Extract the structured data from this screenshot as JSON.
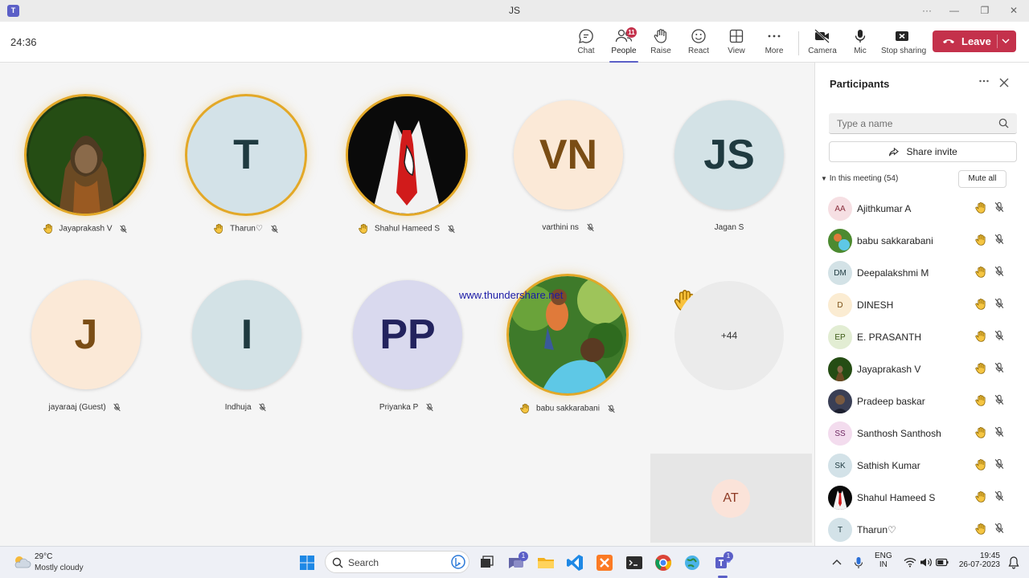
{
  "window": {
    "title": "JS",
    "more": "···",
    "minimize": "—",
    "maximize": "❐",
    "close": "✕"
  },
  "header": {
    "timer": "24:36",
    "tools": [
      {
        "id": "chat",
        "label": "Chat"
      },
      {
        "id": "people",
        "label": "People",
        "badge": "11",
        "active": true
      },
      {
        "id": "raise",
        "label": "Raise"
      },
      {
        "id": "react",
        "label": "React"
      },
      {
        "id": "view",
        "label": "View"
      },
      {
        "id": "more",
        "label": "More"
      },
      {
        "id": "camera",
        "label": "Camera"
      },
      {
        "id": "mic",
        "label": "Mic"
      },
      {
        "id": "share",
        "label": "Stop sharing"
      }
    ],
    "leave_label": "Leave"
  },
  "stage": {
    "tiles": [
      {
        "name": "Jayaprakash V",
        "initials": "",
        "raised": true,
        "muted": true,
        "photo": "hooded-man"
      },
      {
        "name": "Tharun♡",
        "initials": "T",
        "raised": true,
        "muted": true,
        "bg": "#d3e2e8",
        "fg": "#1f3a40"
      },
      {
        "name": "Shahul Hameed S",
        "initials": "",
        "raised": true,
        "muted": true,
        "photo": "suit-tie"
      },
      {
        "name": "varthini ns",
        "initials": "VN",
        "raised": false,
        "muted": true,
        "bg": "#fbe9d7",
        "fg": "#7a4d15"
      },
      {
        "name": "Jagan S",
        "initials": "JS",
        "raised": false,
        "muted": false,
        "bg": "#d3e2e6",
        "fg": "#1f3a40"
      },
      {
        "name": "jayaraaj (Guest)",
        "initials": "J",
        "raised": false,
        "muted": true,
        "bg": "#fbe9d7",
        "fg": "#7a4d15"
      },
      {
        "name": "Indhuja",
        "initials": "I",
        "raised": false,
        "muted": true,
        "bg": "#d3e2e6",
        "fg": "#1f3a40"
      },
      {
        "name": "Priyanka P",
        "initials": "PP",
        "raised": false,
        "muted": true,
        "bg": "#d9d9ee",
        "fg": "#23235e"
      },
      {
        "name": "babu sakkarabani",
        "initials": "",
        "raised": true,
        "muted": true,
        "photo": "father-child"
      }
    ],
    "overflow_label": "+44",
    "watermark": "www.thundershare.net",
    "self_initials": "AT"
  },
  "panel": {
    "title": "Participants",
    "search_placeholder": "Type a name",
    "share_invite": "Share invite",
    "in_meeting": "In this meeting (54)",
    "mute_all": "Mute all",
    "participants": [
      {
        "initials": "AA",
        "name": "Ajithkumar A",
        "bg": "#f6dfe3",
        "fg": "#8a2f3d"
      },
      {
        "initials": "",
        "name": "babu sakkarabani",
        "photo": "green"
      },
      {
        "initials": "DM",
        "name": "Deepalakshmi M",
        "bg": "#d3e2e6",
        "fg": "#1f3a40"
      },
      {
        "initials": "D",
        "name": "DINESH",
        "bg": "#fbecd2",
        "fg": "#7a4d15"
      },
      {
        "initials": "EP",
        "name": "E. PRASANTH",
        "bg": "#e2edd3",
        "fg": "#3b5a14"
      },
      {
        "initials": "",
        "name": "Jayaprakash V",
        "photo": "dark-green"
      },
      {
        "initials": "",
        "name": "Pradeep baskar",
        "photo": "dark"
      },
      {
        "initials": "SS",
        "name": "Santhosh Santhosh",
        "bg": "#f3dcee",
        "fg": "#6e2761"
      },
      {
        "initials": "SK",
        "name": "Sathish Kumar",
        "bg": "#d3e2e8",
        "fg": "#1f3a40"
      },
      {
        "initials": "",
        "name": "Shahul Hameed S",
        "photo": "suit"
      },
      {
        "initials": "T",
        "name": "Tharun♡",
        "bg": "#d3e2e8",
        "fg": "#1f3a40"
      }
    ]
  },
  "taskbar": {
    "temperature": "29°C",
    "condition": "Mostly cloudy",
    "search_label": "Search",
    "chat_badge": "1",
    "teams_badge": "1",
    "lang_top": "ENG",
    "lang_bottom": "IN",
    "time": "19:45",
    "date": "26-07-2023"
  }
}
